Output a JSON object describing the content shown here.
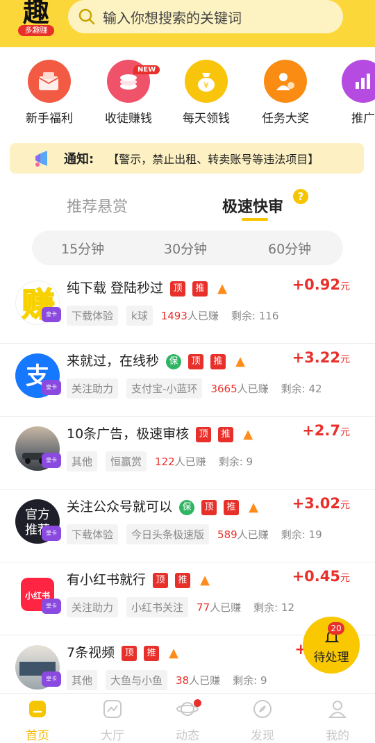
{
  "header": {
    "logo_big": "趣",
    "logo_small": "多趣赚",
    "search_placeholder": "输入你想搜索的关键词"
  },
  "quick_icons": [
    {
      "label": "新手福利",
      "icon": "red-envelope-icon",
      "color": "#f25a43"
    },
    {
      "label": "收徒赚钱",
      "icon": "money-stack-icon",
      "color": "#f0526a",
      "badge": "NEW"
    },
    {
      "label": "每天领钱",
      "icon": "money-bag-icon",
      "color": "#f9c40c"
    },
    {
      "label": "任务大奖",
      "icon": "person-reward-icon",
      "color": "#fa8c14"
    },
    {
      "label": "推广",
      "icon": "chart-icon",
      "color": "#b54be0"
    }
  ],
  "notice": {
    "label": "通知:",
    "message": "【警示，禁止出租、转卖账号等违法项目】"
  },
  "tabs": {
    "tab1": "推荐悬赏",
    "tab2": "极速快审",
    "help": "?"
  },
  "segments": [
    "15分钟",
    "30分钟",
    "60分钟"
  ],
  "tasks": [
    {
      "title": "纯下载 登陆秒过",
      "tags": [
        "顶",
        "推"
      ],
      "price": "+0.92",
      "unit": "元",
      "chips": [
        "下载体验",
        "k球"
      ],
      "count": "1493",
      "count_suffix": "人已赚",
      "remain_label": "剩余:",
      "remain": "116",
      "avatar": "zhuan-avatar"
    },
    {
      "title": "来就过，在线秒",
      "tags": [
        "保",
        "顶",
        "推"
      ],
      "price": "+3.22",
      "unit": "元",
      "chips": [
        "关注助力",
        "支付宝-小蓝环"
      ],
      "count": "3665",
      "count_suffix": "人已赚",
      "remain_label": "剩余:",
      "remain": "42",
      "avatar": "alipay-avatar"
    },
    {
      "title": "10条广告，极速审核",
      "tags": [
        "顶",
        "推"
      ],
      "price": "+2.7",
      "unit": "元",
      "chips": [
        "其他",
        "恒赢赏"
      ],
      "count": "122",
      "count_suffix": "人已赚",
      "remain_label": "剩余:",
      "remain": "9",
      "avatar": "car-avatar"
    },
    {
      "title": "关注公众号就可以",
      "tags": [
        "保",
        "顶",
        "推"
      ],
      "price": "+3.02",
      "unit": "元",
      "chips": [
        "下载体验",
        "今日头条极速版"
      ],
      "count": "589",
      "count_suffix": "人已赚",
      "remain_label": "剩余:",
      "remain": "19",
      "avatar": "official-avatar"
    },
    {
      "title": "有小红书就行",
      "tags": [
        "顶",
        "推"
      ],
      "price": "+0.45",
      "unit": "元",
      "chips": [
        "关注助力",
        "小红书关注"
      ],
      "count": "77",
      "count_suffix": "人已赚",
      "remain_label": "剩余:",
      "remain": "12",
      "avatar": "xiaohongshu-avatar"
    },
    {
      "title": "7条视频",
      "tags": [
        "顶",
        "推"
      ],
      "price": "+",
      "unit": "",
      "chips": [
        "其他",
        "大鱼与小鱼"
      ],
      "count": "38",
      "count_suffix": "人已赚",
      "remain_label": "剩余:",
      "remain": "9",
      "avatar": "video-avatar"
    }
  ],
  "avatar_texts": {
    "zhuan": "赚",
    "official_line1": "官方",
    "official_line2": "推荐",
    "xhs": "小红书",
    "crown": "皇卡"
  },
  "fab": {
    "label": "待处理",
    "count": "20"
  },
  "tabbar": [
    {
      "label": "首页",
      "icon": "home-icon",
      "active": true
    },
    {
      "label": "大厅",
      "icon": "hall-icon"
    },
    {
      "label": "动态",
      "icon": "planet-icon"
    },
    {
      "label": "发现",
      "icon": "compass-icon"
    },
    {
      "label": "我的",
      "icon": "user-icon"
    }
  ]
}
